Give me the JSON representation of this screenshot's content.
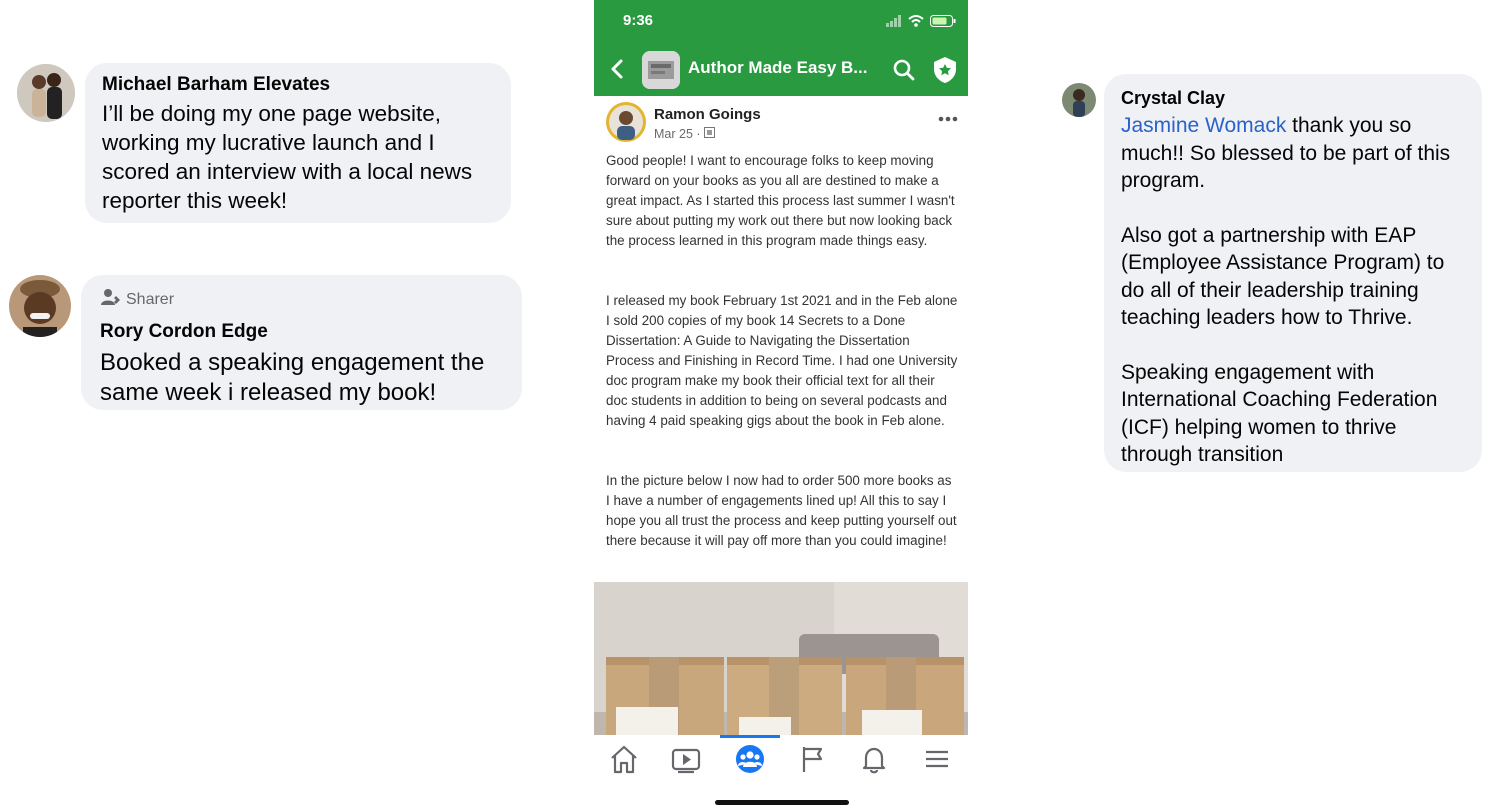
{
  "comments": {
    "left1": {
      "name": "Michael Barham Elevates",
      "message": "I’ll be doing my one page website, working my lucrative launch and I scored an interview with a local news reporter this week!"
    },
    "left2": {
      "badge": "Sharer",
      "name": "Rory Cordon Edge",
      "message": "Booked a speaking engagement the same week i released my book!"
    },
    "right": {
      "name": "Crystal Clay",
      "mention": "Jasmine Womack",
      "message_first": "thank you so much!! So blessed to be part of this program.",
      "message_second": "Also got a partnership with EAP (Employee Assistance Program) to do all of their leadership training teaching leaders how to Thrive.",
      "message_third": "Speaking engagement with International Coaching Federation (ICF) helping women to thrive through transition"
    }
  },
  "phone": {
    "status_time": "9:36",
    "group_title": "Author Made Easy B...",
    "post": {
      "author": "Ramon Goings",
      "date": "Mar 25 · ",
      "paragraph1": "Good people! I want to encourage folks to keep moving forward on your books as you all are destined to make a great impact. As I started this process last summer I wasn't sure about putting my work out there but now looking back the process learned in this program made things easy.",
      "paragraph2": "I released my book February 1st 2021 and in the Feb alone I sold 200 copies of my book 14 Secrets to a Done Dissertation: A Guide to Navigating the Dissertation Process and Finishing in Record Time. I had one University doc program make my book their official text for all their doc students in addition to being on several podcasts and having 4 paid speaking gigs about the book in Feb alone.",
      "paragraph3": "In the picture below I now had to order 500 more books as I have a number of engagements lined up! All this to say I hope you all trust the process and keep putting yourself out there because it will pay off more than you could imagine!"
    },
    "tabs": [
      "home-icon",
      "video-icon",
      "groups-icon",
      "flag-icon",
      "bell-icon",
      "menu-icon"
    ],
    "active_tab": "groups-icon"
  },
  "colors": {
    "header_green": "#2a9a41",
    "bubble": "#eff1f4",
    "mention_blue": "#2a62c9",
    "active_tab_blue": "#1877f2"
  }
}
